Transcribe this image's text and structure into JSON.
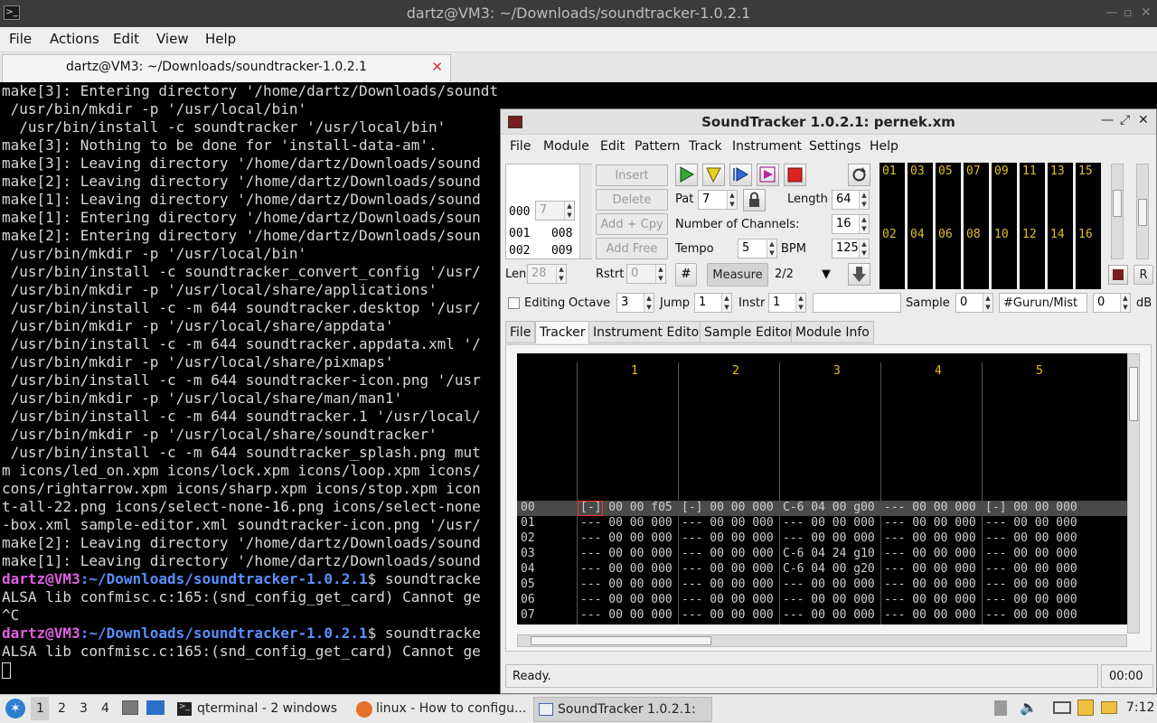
{
  "terminal_window": {
    "title": "dartz@VM3: ~/Downloads/soundtracker-1.0.2.1",
    "menu": [
      "File",
      "Actions",
      "Edit",
      "View",
      "Help"
    ],
    "tab_label": "dartz@VM3: ~/Downloads/soundtracker-1.0.2.1",
    "lines": [
      "make[3]: Entering directory '/home/dartz/Downloads/soundtracker-1.0.2.1/app'",
      " /usr/bin/mkdir -p '/usr/local/bin'",
      "  /usr/bin/install -c soundtracker '/usr/local/bin'",
      "make[3]: Nothing to be done for 'install-data-am'.",
      "make[3]: Leaving directory '/home/dartz/Downloads/sound",
      "make[2]: Leaving directory '/home/dartz/Downloads/sound",
      "make[1]: Leaving directory '/home/dartz/Downloads/sound",
      "make[1]: Entering directory '/home/dartz/Downloads/soun",
      "make[2]: Entering directory '/home/dartz/Downloads/soun",
      " /usr/bin/mkdir -p '/usr/local/bin'",
      " /usr/bin/install -c soundtracker_convert_config '/usr/",
      " /usr/bin/mkdir -p '/usr/local/share/applications'",
      " /usr/bin/install -c -m 644 soundtracker.desktop '/usr/",
      " /usr/bin/mkdir -p '/usr/local/share/appdata'",
      " /usr/bin/install -c -m 644 soundtracker.appdata.xml '/",
      " /usr/bin/mkdir -p '/usr/local/share/pixmaps'",
      " /usr/bin/install -c -m 644 soundtracker-icon.png '/usr",
      " /usr/bin/mkdir -p '/usr/local/share/man/man1'",
      " /usr/bin/install -c -m 644 soundtracker.1 '/usr/local/",
      " /usr/bin/mkdir -p '/usr/local/share/soundtracker'",
      " /usr/bin/install -c -m 644 soundtracker_splash.png mut",
      "m icons/led_on.xpm icons/lock.xpm icons/loop.xpm icons/",
      "cons/rightarrow.xpm icons/sharp.xpm icons/stop.xpm icon",
      "t-all-22.png icons/select-none-16.png icons/select-none",
      "-box.xml sample-editor.xml soundtracker-icon.png '/usr/",
      "make[2]: Leaving directory '/home/dartz/Downloads/sound",
      "make[1]: Leaving directory '/home/dartz/Downloads/sound"
    ],
    "prompt_user": "dartz@VM3",
    "prompt_path": ":~/Downloads/soundtracker-1.0.2.1",
    "prompt_cmd": "$ soundtracke",
    "alsa_line": "ALSA lib confmisc.c:165:(snd_config_get_card) Cannot ge",
    "interrupt": "^C"
  },
  "soundtracker": {
    "title": "SoundTracker 1.0.2.1: pernek.xm",
    "menu": [
      "File",
      "Module",
      "Edit",
      "Pattern",
      "Track",
      "Instrument",
      "Settings",
      "Help"
    ],
    "order_list": {
      "pos_value": "000",
      "pos_spin": "7",
      "rows": [
        [
          "001",
          "008"
        ],
        [
          "002",
          "009"
        ]
      ]
    },
    "len_label": "Len",
    "len_value": "28",
    "rstrt_label": "Rstrt",
    "rstrt_value": "0",
    "order_buttons": [
      "Insert",
      "Delete",
      "Add + Cpy",
      "Add Free"
    ],
    "pat_label": "Pat",
    "pat_value": "7",
    "length_label": "Length",
    "length_value": "64",
    "channels_label": "Number of Channels:",
    "channels_value": "16",
    "tempo_label": "Tempo",
    "tempo_value": "5",
    "bpm_label": "BPM",
    "bpm_value": "125",
    "sharp_label": "#",
    "measure_label": "Measure",
    "measure_value": "2/2",
    "scope_channels_top": [
      "01",
      "03",
      "05",
      "07",
      "09",
      "11",
      "13",
      "15"
    ],
    "scope_channels_bottom": [
      "02",
      "04",
      "06",
      "08",
      "10",
      "12",
      "14",
      "16"
    ],
    "r_label": "R",
    "editing_label": "Editing",
    "octave_label": "Octave",
    "octave_value": "3",
    "jump_label": "Jump",
    "jump_value": "1",
    "instr_label": "Instr",
    "instr_value": "1",
    "sample_label": "Sample",
    "sample_value": "0",
    "sample_name": "#Gurun/Mist",
    "db_value": "0",
    "db_label": "dB",
    "tabs": [
      "File",
      "Tracker",
      "Instrument Editor",
      "Sample Editor",
      "Module Info"
    ],
    "active_tab": "Tracker",
    "channel_headers": [
      "1",
      "2",
      "3",
      "4",
      "5"
    ],
    "rows": [
      {
        "num": "00",
        "cells": [
          "[-] 00 00 f05",
          "[-] 00 00 000",
          "C-6 04 00 g00",
          "--- 00 00 000",
          "[-] 00 00 000"
        ]
      },
      {
        "num": "01",
        "cells": [
          "--- 00 00 000",
          "--- 00 00 000",
          "--- 00 00 000",
          "--- 00 00 000",
          "--- 00 00 000"
        ]
      },
      {
        "num": "02",
        "cells": [
          "--- 00 00 000",
          "--- 00 00 000",
          "--- 00 00 000",
          "--- 00 00 000",
          "--- 00 00 000"
        ]
      },
      {
        "num": "03",
        "cells": [
          "--- 00 00 000",
          "--- 00 00 000",
          "C-6 04 24 g10",
          "--- 00 00 000",
          "--- 00 00 000"
        ]
      },
      {
        "num": "04",
        "cells": [
          "--- 00 00 000",
          "--- 00 00 000",
          "C-6 04 00 g20",
          "--- 00 00 000",
          "--- 00 00 000"
        ]
      },
      {
        "num": "05",
        "cells": [
          "--- 00 00 000",
          "--- 00 00 000",
          "--- 00 00 000",
          "--- 00 00 000",
          "--- 00 00 000"
        ]
      },
      {
        "num": "06",
        "cells": [
          "--- 00 00 000",
          "--- 00 00 000",
          "--- 00 00 000",
          "--- 00 00 000",
          "--- 00 00 000"
        ]
      },
      {
        "num": "07",
        "cells": [
          "--- 00 00 000",
          "--- 00 00 000",
          "--- 00 00 000",
          "--- 00 00 000",
          "--- 00 00 000"
        ]
      }
    ],
    "status": "Ready.",
    "time": "00:00"
  },
  "taskbar": {
    "workspaces": [
      "1",
      "2",
      "3",
      "4"
    ],
    "tasks": [
      "qterminal - 2 windows",
      "linux - How to configu...",
      "SoundTracker 1.0.2.1: ..."
    ],
    "clock": "7:12"
  },
  "colors": {
    "accent_yellow": "#e0c020",
    "prompt_user": "#e060e0",
    "prompt_path": "#5890ff",
    "tracker_bg": "#000000"
  }
}
